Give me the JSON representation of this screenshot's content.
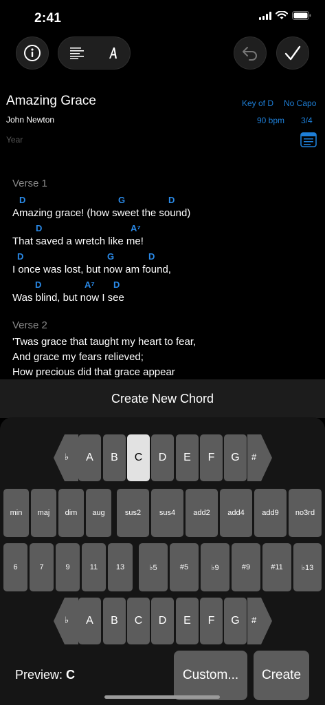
{
  "status_bar": {
    "time": "2:41"
  },
  "song": {
    "title": "Amazing Grace",
    "artist": "John Newton",
    "year_placeholder": "Year",
    "key": "Key of D",
    "capo": "No Capo",
    "tempo": "90 bpm",
    "time_signature": "3/4"
  },
  "sections": [
    {
      "label": "Verse 1",
      "lines": [
        {
          "chords": [
            {
              "name": "D"
            },
            {
              "name": "G"
            },
            {
              "name": "D"
            }
          ],
          "text": "Amazing grace! (how sweet the sound)"
        },
        {
          "chords": [
            {
              "name": "D"
            },
            {
              "name": "A⁷"
            }
          ],
          "text": "That saved a wretch like me!"
        },
        {
          "chords": [
            {
              "name": "D"
            },
            {
              "name": "G"
            },
            {
              "name": "D"
            }
          ],
          "text": "I once was lost, but now am found,"
        },
        {
          "chords": [
            {
              "name": "D"
            },
            {
              "name": "A⁷"
            },
            {
              "name": "D"
            }
          ],
          "text": "Was blind, but now I see"
        }
      ]
    },
    {
      "label": "Verse 2",
      "lines": [
        {
          "text": "'Twas grace that taught my heart to fear,"
        },
        {
          "text": "And grace my fears relieved;"
        },
        {
          "text": "How precious did that grace appear"
        }
      ]
    }
  ],
  "chord_sheet": {
    "title": "Create New Chord",
    "root_notes": [
      "A",
      "B",
      "C",
      "D",
      "E",
      "F",
      "G"
    ],
    "flat_label": "♭",
    "sharp_label": "#",
    "selected_root": "C",
    "qualities": [
      "min",
      "maj",
      "dim",
      "aug"
    ],
    "suspensions": [
      "sus2",
      "sus4",
      "add2",
      "add4",
      "add9",
      "no3rd"
    ],
    "extensions": [
      "6",
      "7",
      "9",
      "11",
      "13"
    ],
    "alterations": [
      "♭5",
      "#5",
      "♭9",
      "#9",
      "#11",
      "♭13"
    ],
    "bass_notes": [
      "A",
      "B",
      "C",
      "D",
      "E",
      "F",
      "G"
    ],
    "preview_label": "Preview:",
    "preview_value": "C",
    "custom_button": "Custom...",
    "create_button": "Create"
  },
  "colors": {
    "accent": "#2a8ae8",
    "key": "#5c5c5c",
    "selected_key": "#e2e2e2"
  }
}
